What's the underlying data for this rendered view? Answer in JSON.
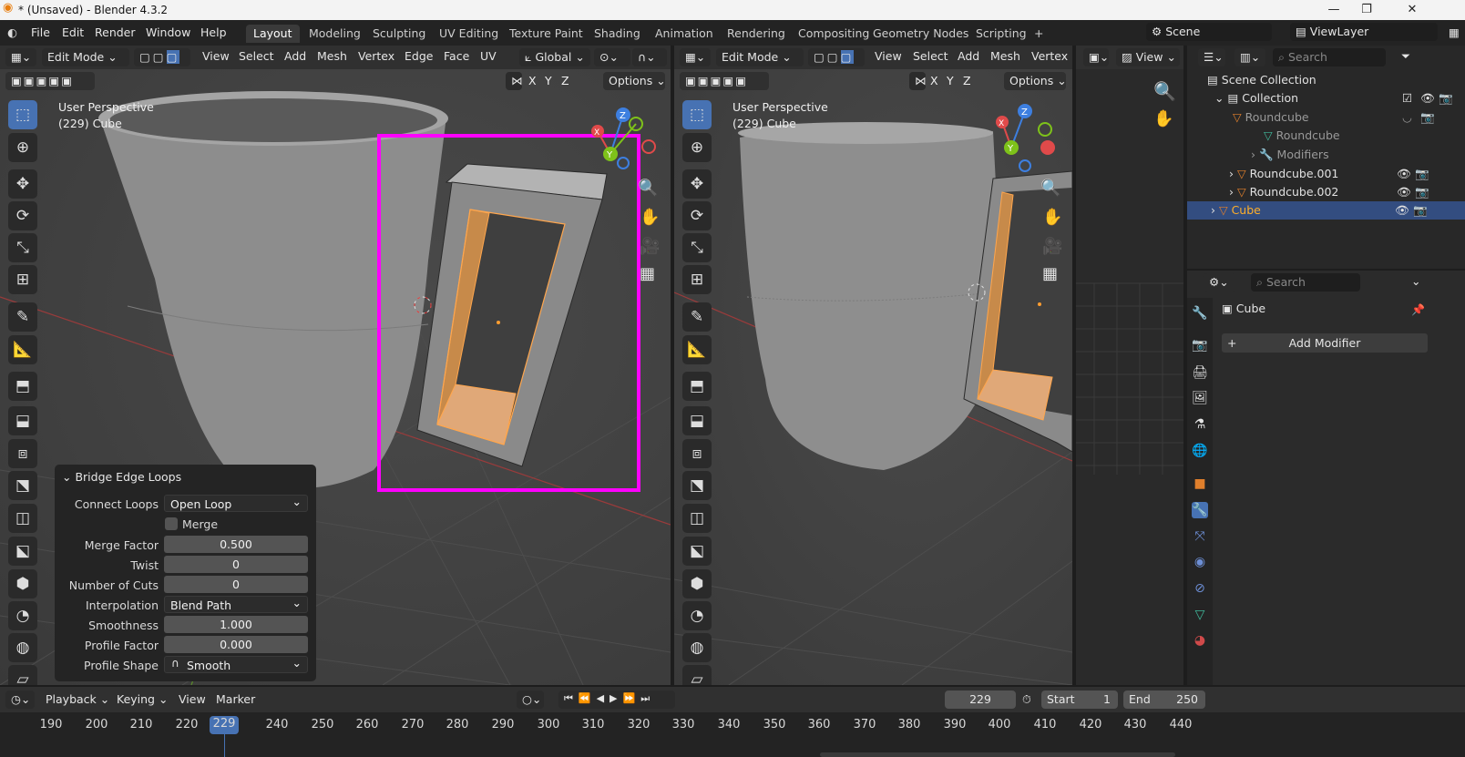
{
  "window": {
    "title": "* (Unsaved) - Blender 4.3.2"
  },
  "menus": [
    "File",
    "Edit",
    "Render",
    "Window",
    "Help"
  ],
  "workspaces": [
    "Layout",
    "Modeling",
    "Sculpting",
    "UV Editing",
    "Texture Paint",
    "Shading",
    "Animation",
    "Rendering",
    "Compositing",
    "Geometry Nodes",
    "Scripting",
    "+"
  ],
  "scene": {
    "scene_name": "Scene",
    "view_layer": "ViewLayer"
  },
  "viewport_left": {
    "mode": "Edit Mode",
    "menu": [
      "View",
      "Select",
      "Add",
      "Mesh",
      "Vertex",
      "Edge",
      "Face",
      "UV"
    ],
    "orientation": "Global",
    "axes": [
      "X",
      "Y",
      "Z"
    ],
    "options": "Options",
    "perspective": "User Perspective",
    "object": "(229) Cube"
  },
  "viewport_right": {
    "mode": "Edit Mode",
    "menu": [
      "View",
      "Select",
      "Add",
      "Mesh",
      "Vertex"
    ],
    "axes": [
      "X",
      "Y",
      "Z"
    ],
    "options": "Options",
    "perspective": "User Perspective",
    "object": "(229) Cube"
  },
  "image_editor": {
    "view": "View"
  },
  "gizmo": {
    "x": "X",
    "y": "Y",
    "z": "Z"
  },
  "operator_panel": {
    "title": "Bridge Edge Loops",
    "fields": [
      {
        "label": "Connect Loops",
        "value": "Open Loop",
        "kind": "dropdown"
      },
      {
        "label": "",
        "value": "Merge",
        "kind": "checkbox"
      },
      {
        "label": "Merge Factor",
        "value": "0.500",
        "kind": "number"
      },
      {
        "label": "Twist",
        "value": "0",
        "kind": "number"
      },
      {
        "label": "Number of Cuts",
        "value": "0",
        "kind": "number"
      },
      {
        "label": "Interpolation",
        "value": "Blend Path",
        "kind": "dropdown"
      },
      {
        "label": "Smoothness",
        "value": "1.000",
        "kind": "number"
      },
      {
        "label": "Profile Factor",
        "value": "0.000",
        "kind": "number"
      },
      {
        "label": "Profile Shape",
        "value": "Smooth",
        "kind": "dropdown"
      }
    ]
  },
  "outliner": {
    "search": "Search",
    "items": [
      "Scene Collection",
      "Collection",
      "Roundcube",
      "Roundcube",
      "Modifiers",
      "Roundcube.001",
      "Roundcube.002",
      "Cube"
    ]
  },
  "properties": {
    "search": "Search",
    "object": "Cube",
    "add_modifier": "Add Modifier"
  },
  "timeline": {
    "menu": [
      "Playback",
      "Keying",
      "View",
      "Marker"
    ],
    "current": "229",
    "start_label": "Start",
    "start": "1",
    "end_label": "End",
    "end": "250",
    "ticks": [
      "190",
      "200",
      "210",
      "220",
      "229",
      "240",
      "250",
      "260",
      "270",
      "280",
      "290",
      "300",
      "310",
      "320",
      "330",
      "340",
      "350",
      "360",
      "370",
      "380",
      "390",
      "400",
      "410",
      "420",
      "430",
      "440"
    ]
  },
  "colors": {
    "accent": "#4772b3",
    "highlight": "#ff00ff",
    "selected_face": "#e0a060",
    "x_axis": "#e04a4a",
    "y_axis": "#7ec21a",
    "z_axis": "#3d7fe0"
  }
}
